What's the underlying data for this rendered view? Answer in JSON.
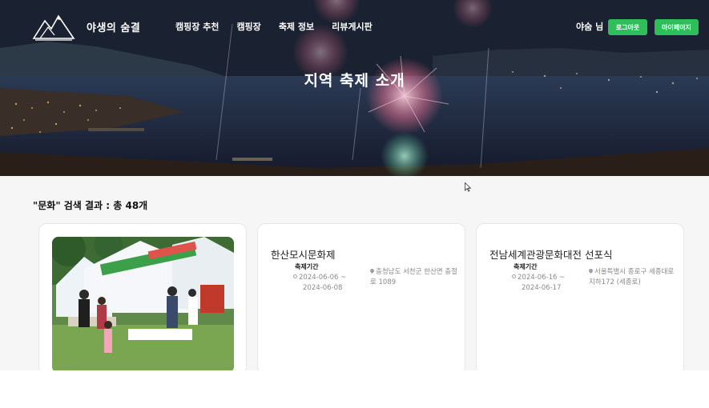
{
  "header": {
    "brand": "야생의 숨결",
    "menu": [
      "캠핑장 추천",
      "캠핑장",
      "축제 정보",
      "리뷰게시판"
    ],
    "user": "야숨 님",
    "logout_label": "로그아웃",
    "mypage_label": "마이페이지"
  },
  "hero": {
    "title": "지역 축제 소개"
  },
  "search": {
    "result_text": "\"문화\" 검색 결과 : 총 48개"
  },
  "cards": [
    {
      "type": "image",
      "image": "festival-tent-photo"
    },
    {
      "title": "한산모시문화제",
      "period_label": "축제기간",
      "date_start": "2024-06-06 ~",
      "date_end": "2024-06-08",
      "address": "충청남도 서천군 한산면 충절로 1089"
    },
    {
      "title": "전남세계관광문화대전 선포식",
      "period_label": "축제기간",
      "date_start": "2024-06-16 ~",
      "date_end": "2024-06-17",
      "address": "서울특별시 종로구 세종대로 지하172 (세종로)"
    }
  ],
  "colors": {
    "accent_green": "#2fbf5a",
    "hero_dark": "#1b2433"
  }
}
